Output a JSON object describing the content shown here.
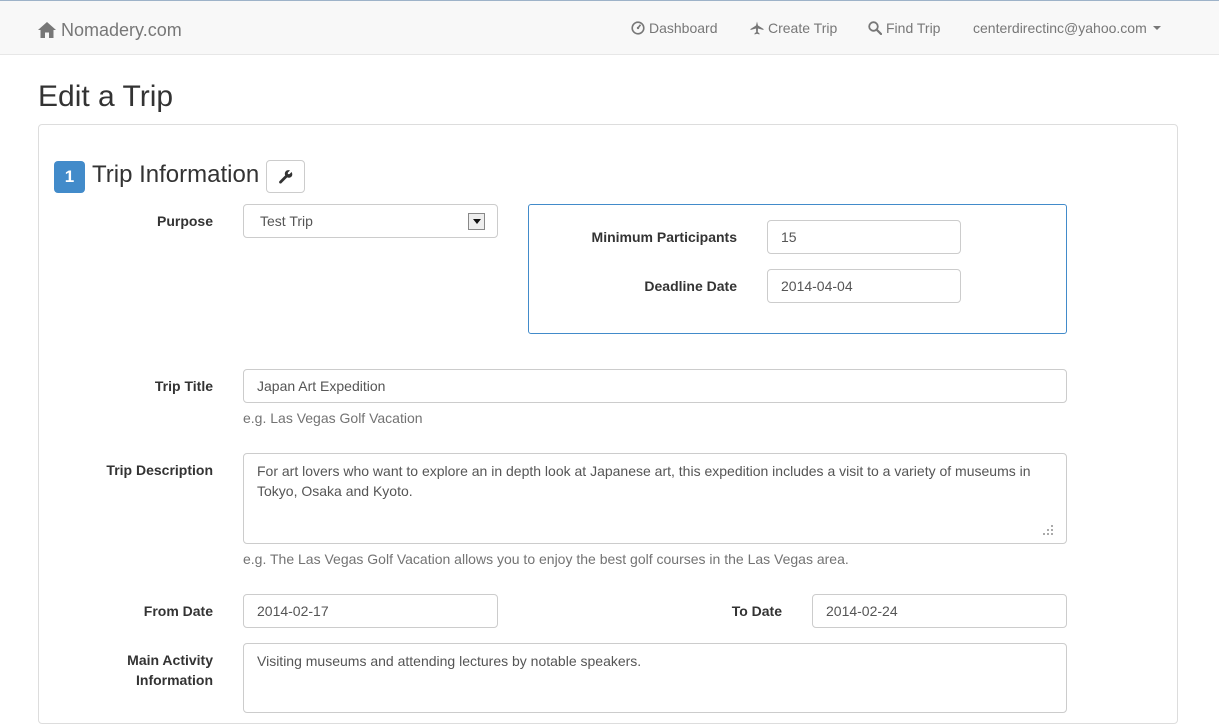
{
  "navbar": {
    "brand": "Nomadery.com",
    "items": [
      {
        "label": "Dashboard",
        "icon": "dashboard-icon"
      },
      {
        "label": "Create Trip",
        "icon": "plane-icon"
      },
      {
        "label": "Find Trip",
        "icon": "search-icon"
      },
      {
        "label": "centerdirectinc@yahoo.com",
        "icon": "caret-down-icon"
      }
    ]
  },
  "page": {
    "title": "Edit a Trip"
  },
  "section": {
    "number": "1",
    "title": "Trip Information",
    "edit_icon": "wrench-icon"
  },
  "form": {
    "purpose": {
      "label": "Purpose",
      "value": "Test Trip"
    },
    "min_participants": {
      "label": "Minimum Participants",
      "value": "15"
    },
    "deadline_date": {
      "label": "Deadline Date",
      "value": "2014-04-04"
    },
    "trip_title": {
      "label": "Trip Title",
      "value": "Japan Art Expedition",
      "help": "e.g. Las Vegas Golf Vacation"
    },
    "trip_description": {
      "label": "Trip Description",
      "value": "For art lovers who want to explore an in depth look at Japanese art, this expedition includes a visit to a variety of museums in Tokyo, Osaka and Kyoto.",
      "help": "e.g. The Las Vegas Golf Vacation allows you to enjoy the best golf courses in the Las Vegas area."
    },
    "from_date": {
      "label": "From Date",
      "value": "2014-02-17"
    },
    "to_date": {
      "label": "To Date",
      "value": "2014-02-24"
    },
    "main_activity": {
      "label_line1": "Main Activity",
      "label_line2": "Information",
      "value": "Visiting museums and attending lectures by notable speakers."
    }
  },
  "colors": {
    "navbar_bg": "#f8f8f8",
    "primary": "#428bca",
    "text_muted": "#737373",
    "nav_text": "#777777"
  }
}
